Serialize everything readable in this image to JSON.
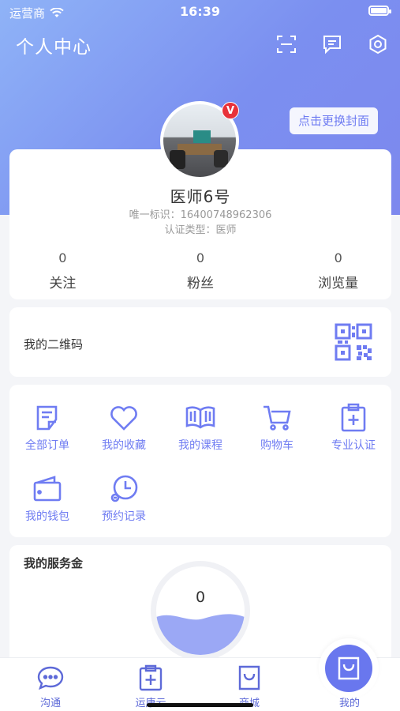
{
  "status_bar": {
    "carrier": "运营商",
    "time": "16:39"
  },
  "header": {
    "title": "个人中心",
    "icons": [
      "scan-icon",
      "message-icon",
      "settings-icon"
    ]
  },
  "cover_button": "点击更换封面",
  "profile": {
    "name": "医师6号",
    "id_line": "唯一标识：16400748962306",
    "type_line": "认证类型：医师",
    "badge": "V",
    "stats": [
      {
        "value": "0",
        "label": "关注"
      },
      {
        "value": "0",
        "label": "粉丝"
      },
      {
        "value": "0",
        "label": "浏览量"
      }
    ]
  },
  "qr": {
    "label": "我的二维码",
    "icon": "qr-code-icon"
  },
  "menu": {
    "items": [
      {
        "label": "全部订单",
        "icon": "order-icon"
      },
      {
        "label": "我的收藏",
        "icon": "heart-icon"
      },
      {
        "label": "我的课程",
        "icon": "book-icon"
      },
      {
        "label": "购物车",
        "icon": "cart-icon"
      },
      {
        "label": "专业认证",
        "icon": "certification-icon"
      },
      {
        "label": "我的钱包",
        "icon": "wallet-icon"
      },
      {
        "label": "预约记录",
        "icon": "clock-icon"
      }
    ]
  },
  "service": {
    "title": "我的服务金",
    "value": "0"
  },
  "tabbar": {
    "items": [
      {
        "label": "沟通",
        "icon": "chat-icon"
      },
      {
        "label": "运康云",
        "icon": "clipboard-plus-icon"
      },
      {
        "label": "商城",
        "icon": "shop-bag-icon"
      },
      {
        "label": "我的",
        "icon": "profile-bag-icon",
        "active": true
      }
    ]
  },
  "colors": {
    "accent": "#6f7cf2",
    "hero_start": "#8fb3f7",
    "hero_end": "#7d88ee",
    "badge": "#e8323a"
  }
}
